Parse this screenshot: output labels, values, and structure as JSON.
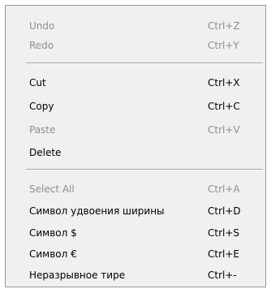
{
  "context_menu": {
    "items": [
      {
        "label": "Undo",
        "shortcut": "Ctrl+Z",
        "enabled": false
      },
      {
        "label": "Redo",
        "shortcut": "Ctrl+Y",
        "enabled": false
      },
      {
        "label": "Cut",
        "shortcut": "Ctrl+X",
        "enabled": true
      },
      {
        "label": "Copy",
        "shortcut": "Ctrl+C",
        "enabled": true
      },
      {
        "label": "Paste",
        "shortcut": "Ctrl+V",
        "enabled": false
      },
      {
        "label": "Delete",
        "shortcut": "",
        "enabled": true
      },
      {
        "label": "Select All",
        "shortcut": "Ctrl+A",
        "enabled": false
      },
      {
        "label": "Символ удвоения ширины",
        "shortcut": "Ctrl+D",
        "enabled": true
      },
      {
        "label": "Символ $",
        "shortcut": "Ctrl+S",
        "enabled": true
      },
      {
        "label": "Символ €",
        "shortcut": "Ctrl+E",
        "enabled": true
      },
      {
        "label": "Неразрывное тире",
        "shortcut": "Ctrl+-",
        "enabled": true
      }
    ]
  }
}
